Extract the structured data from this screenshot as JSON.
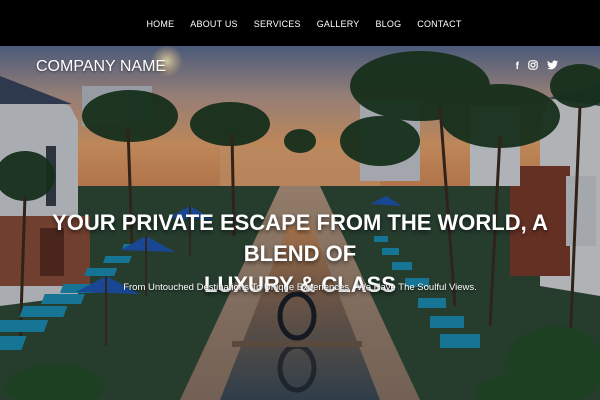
{
  "nav": {
    "items": [
      {
        "label": "HOME"
      },
      {
        "label": "ABOUT US"
      },
      {
        "label": "SERVICES"
      },
      {
        "label": "GALLERY"
      },
      {
        "label": "BLOG"
      },
      {
        "label": "CONTACT"
      }
    ]
  },
  "hero": {
    "company_name": "COMPANY NAME",
    "headline_line1": "YOUR PRIVATE ESCAPE FROM THE WORLD, A BLEND OF",
    "headline_line2": "LUXURY & CLASS",
    "subline": "From Untouched Destinations To Unique Experiences . We Have The Soulful Views."
  },
  "social": {
    "facebook_glyph": "f",
    "instagram_glyph": "◎",
    "twitter_glyph": "🐦"
  },
  "colors": {
    "nav_background": "#000000",
    "text": "#ffffff",
    "pool_chair": "#1c8fb6",
    "umbrella": "#1f57b5"
  }
}
